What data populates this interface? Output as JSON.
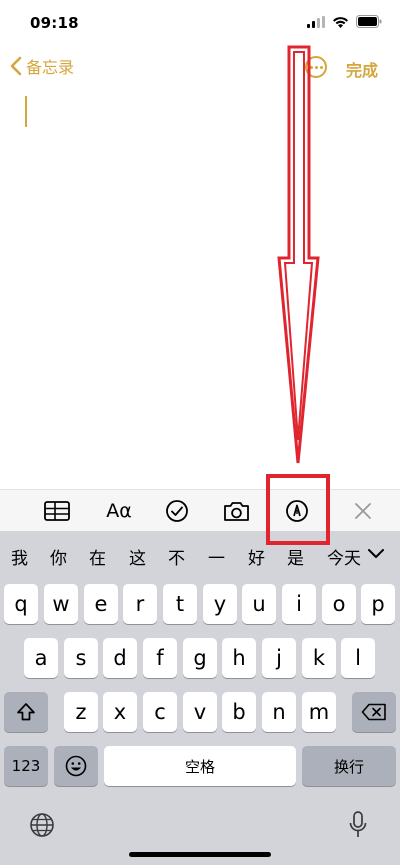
{
  "status": {
    "time": "09:18"
  },
  "nav": {
    "back_label": "备忘录",
    "done_label": "完成"
  },
  "toolbar": {
    "format_label": "Aα"
  },
  "suggestions": [
    "我",
    "你",
    "在",
    "这",
    "不",
    "一",
    "好",
    "是",
    "今天"
  ],
  "keyboard": {
    "row1": [
      "q",
      "w",
      "e",
      "r",
      "t",
      "y",
      "u",
      "i",
      "o",
      "p"
    ],
    "row2": [
      "a",
      "s",
      "d",
      "f",
      "g",
      "h",
      "j",
      "k",
      "l"
    ],
    "row3": [
      "z",
      "x",
      "c",
      "v",
      "b",
      "n",
      "m"
    ],
    "numbers_label": "123",
    "space_label": "空格",
    "return_label": "换行"
  },
  "colors": {
    "accent": "#d4a63c",
    "annotation": "#e0252f"
  },
  "icons": [
    "table-icon",
    "checklist-icon",
    "camera-icon",
    "markup-pen-icon",
    "close-icon",
    "shift-icon",
    "delete-icon",
    "emoji-icon",
    "globe-icon",
    "microphone-icon",
    "chevron-down-icon"
  ]
}
